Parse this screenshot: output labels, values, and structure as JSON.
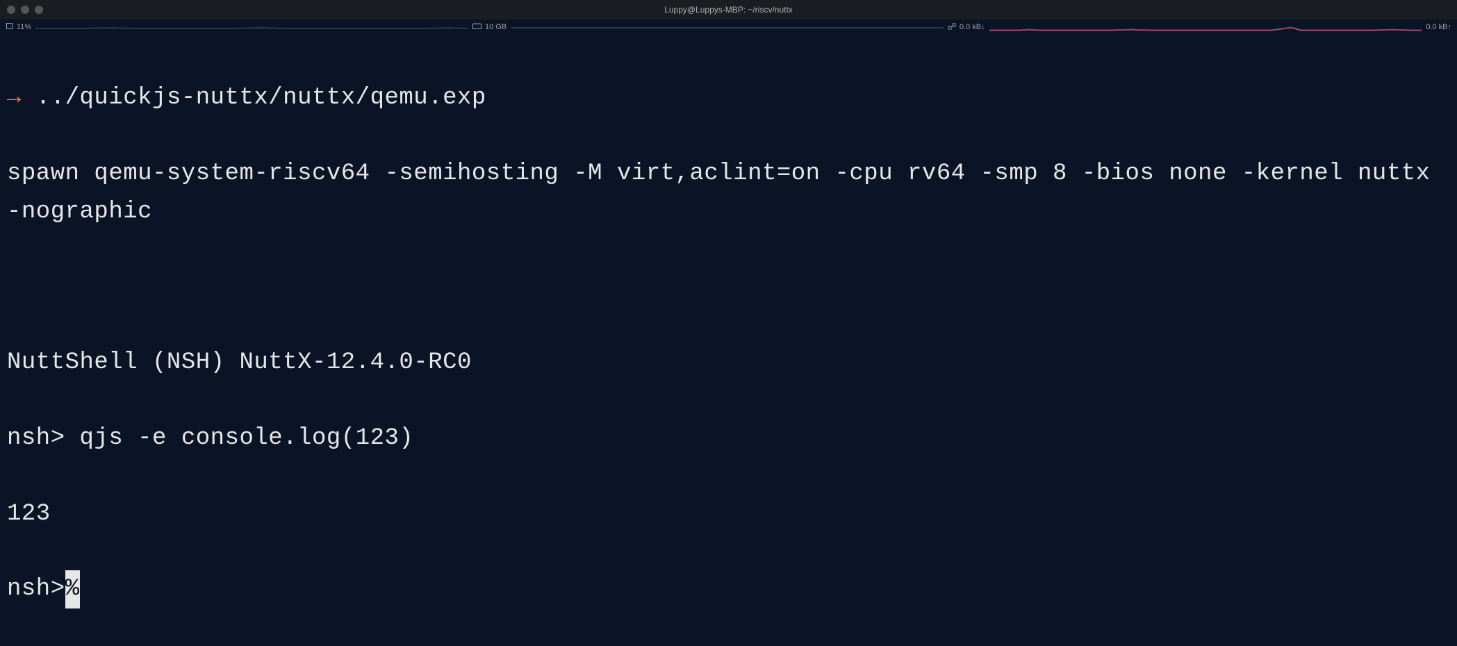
{
  "titlebar": {
    "title": "Luppy@Luppys-MBP: ~/riscv/nuttx"
  },
  "statusbar": {
    "cpu_label": "11%",
    "mem_label": "10 GB",
    "net_down": "0.0 kB↓",
    "net_up": "0.0 kB↑"
  },
  "terminal": {
    "prompt_arrow": "→",
    "command": "../quickjs-nuttx/nuttx/qemu.exp",
    "spawn_line": "spawn qemu-system-riscv64 -semihosting -M virt,aclint=on -cpu rv64 -smp 8 -bios none -kernel nuttx -nographic",
    "shell_banner": "NuttShell (NSH) NuttX-12.4.0-RC0",
    "nsh_prompt1": "nsh> ",
    "nsh_cmd1": "qjs -e console.log(123)",
    "output1": "123",
    "nsh_prompt2": "nsh>",
    "cursor_char": "%"
  }
}
